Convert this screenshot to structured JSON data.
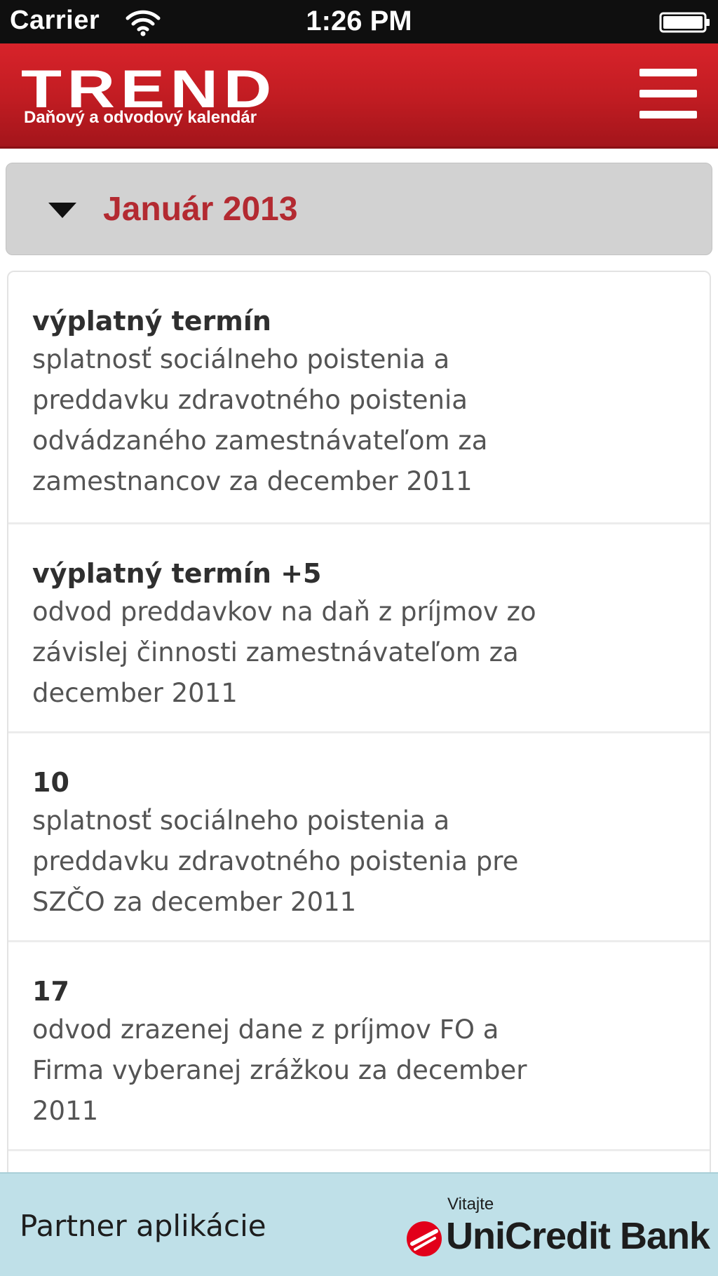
{
  "status_bar": {
    "carrier": "Carrier",
    "time": "1:26 PM",
    "wifi_icon": "wifi-icon",
    "battery_icon": "battery-icon"
  },
  "header": {
    "logo": "TREND",
    "subtitle": "Daňový a odvodový kalendár",
    "menu_icon": "hamburger-menu-icon",
    "background_color": "#c01c22"
  },
  "month": {
    "title": "Január 2013",
    "caret_icon": "caret-down-icon",
    "title_color": "#b32a31"
  },
  "events": [
    {
      "date": "výplatný termín",
      "lines": [
        "splatnosť sociálneho poistenia a",
        "preddavku zdravotného poistenia",
        "odvádzaného zamestnávateľom za",
        "zamestnancov za december 2011"
      ]
    },
    {
      "date": "výplatný termín +5",
      "lines": [
        "odvod preddavkov na daň z príjmov zo",
        "závislej činnosti zamestnávateľom za",
        "december 2011"
      ]
    },
    {
      "date": "10",
      "lines": [
        "splatnosť sociálneho poistenia a",
        "preddavku zdravotného poistenia pre",
        "SZČO za december 2011"
      ]
    },
    {
      "date": "17",
      "lines": [
        "odvod zrazenej dane z príjmov FO a",
        "Firma vyberanej zrážkou za december",
        "2011"
      ]
    }
  ],
  "footer": {
    "label": "Partner aplikácie",
    "logo_welcome": "Vitajte",
    "logo_name": "UniCredit Bank",
    "logo_icon": "unicredit-logo-icon",
    "background_color": "#bfe0e8"
  }
}
